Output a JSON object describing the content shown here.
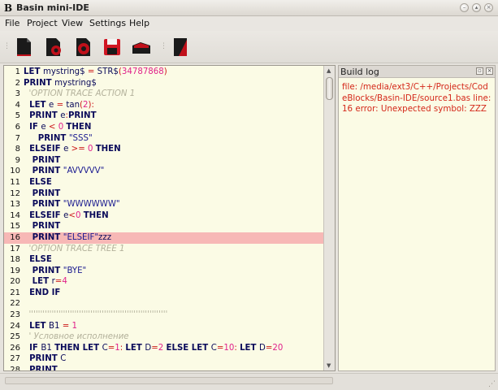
{
  "window": {
    "icon_letter": "B",
    "title": "Basin mini-IDE",
    "controls": [
      "minimize-icon",
      "maximize-icon",
      "close-icon"
    ]
  },
  "menu": [
    "File",
    "Project",
    "View",
    "Settings",
    "Help"
  ],
  "toolbar": {
    "buttons": [
      "new-file-icon",
      "open-gear-icon",
      "build-gear-icon",
      "save-icon",
      "run-icon",
      "notebook-icon"
    ]
  },
  "editor": {
    "highlight_line": 16,
    "lines": [
      {
        "n": "1",
        "t": [
          [
            "kw",
            "LET "
          ],
          [
            "id",
            "mystring$ "
          ],
          [
            "op",
            "= "
          ],
          [
            "id",
            "STR$"
          ],
          [
            "op",
            "("
          ],
          [
            "num",
            "34787868"
          ],
          [
            "op",
            ")"
          ]
        ]
      },
      {
        "n": "2",
        "t": [
          [
            "kw",
            "PRINT "
          ],
          [
            "id",
            "mystring$"
          ]
        ]
      },
      {
        "n": "3",
        "t": [
          [
            "cm",
            "  'OPTION TRACE ACTION 1"
          ]
        ]
      },
      {
        "n": "4",
        "t": [
          [
            "kw",
            "  LET "
          ],
          [
            "id",
            "e "
          ],
          [
            "op",
            "= "
          ],
          [
            "id",
            "tan"
          ],
          [
            "op",
            "("
          ],
          [
            "num",
            "2"
          ],
          [
            "op",
            "):"
          ]
        ]
      },
      {
        "n": "5",
        "t": [
          [
            "kw",
            "  PRINT "
          ],
          [
            "id",
            "e"
          ],
          [
            "op",
            ":"
          ],
          [
            "kw",
            "PRINT"
          ]
        ]
      },
      {
        "n": "6",
        "t": [
          [
            "kw",
            "  IF "
          ],
          [
            "id",
            "e "
          ],
          [
            "op",
            "< "
          ],
          [
            "num",
            "0 "
          ],
          [
            "kw",
            "THEN"
          ]
        ]
      },
      {
        "n": "7",
        "t": [
          [
            "kw",
            "     PRINT "
          ],
          [
            "str",
            "\"SSS\""
          ]
        ]
      },
      {
        "n": "8",
        "t": [
          [
            "kw",
            "  ELSEIF "
          ],
          [
            "id",
            "e "
          ],
          [
            "op",
            ">= "
          ],
          [
            "num",
            "0 "
          ],
          [
            "kw",
            "THEN"
          ]
        ]
      },
      {
        "n": "9",
        "t": [
          [
            "kw",
            "   PRINT"
          ]
        ]
      },
      {
        "n": "10",
        "t": [
          [
            "kw",
            "   PRINT "
          ],
          [
            "str",
            "\"AVVVVV\""
          ]
        ]
      },
      {
        "n": "11",
        "t": [
          [
            "kw",
            "  ELSE"
          ]
        ]
      },
      {
        "n": "12",
        "t": [
          [
            "kw",
            "   PRINT"
          ]
        ]
      },
      {
        "n": "13",
        "t": [
          [
            "kw",
            "   PRINT "
          ],
          [
            "str",
            "\"WWWWWW\""
          ]
        ]
      },
      {
        "n": "14",
        "t": [
          [
            "kw",
            "  ELSEIF "
          ],
          [
            "id",
            "e"
          ],
          [
            "op",
            "<"
          ],
          [
            "num",
            "0 "
          ],
          [
            "kw",
            "THEN"
          ]
        ]
      },
      {
        "n": "15",
        "t": [
          [
            "kw",
            "   PRINT"
          ]
        ]
      },
      {
        "n": "16",
        "t": [
          [
            "kw",
            "   PRINT "
          ],
          [
            "str",
            "\"ELSEIF\""
          ],
          [
            "id",
            "zzz"
          ]
        ]
      },
      {
        "n": "17",
        "t": [
          [
            "cm",
            "  'OPTION TRACE TREE 1"
          ]
        ]
      },
      {
        "n": "18",
        "t": [
          [
            "kw",
            "  ELSE"
          ]
        ]
      },
      {
        "n": "19",
        "t": [
          [
            "kw",
            "   PRINT "
          ],
          [
            "str",
            "\"BYE\""
          ]
        ]
      },
      {
        "n": "20",
        "t": [
          [
            "kw",
            "   LET "
          ],
          [
            "id",
            "r"
          ],
          [
            "op",
            "="
          ],
          [
            "num",
            "4"
          ]
        ]
      },
      {
        "n": "21",
        "t": [
          [
            "kw",
            "  END IF"
          ]
        ]
      },
      {
        "n": "22",
        "t": []
      },
      {
        "n": "23",
        "t": [
          [
            "cm",
            "  '''''''''''''''''''''''''''''''''''''''''''''''''''''''''''''"
          ]
        ]
      },
      {
        "n": "24",
        "t": [
          [
            "kw",
            "  LET "
          ],
          [
            "id",
            "B1 "
          ],
          [
            "op",
            "= "
          ],
          [
            "num",
            "1"
          ]
        ]
      },
      {
        "n": "25",
        "t": [
          [
            "cm",
            "  ' Условное исполнение"
          ]
        ]
      },
      {
        "n": "26",
        "t": [
          [
            "kw",
            "  IF "
          ],
          [
            "id",
            "B1 "
          ],
          [
            "kw",
            "THEN LET "
          ],
          [
            "id",
            "C"
          ],
          [
            "op",
            "="
          ],
          [
            "num",
            "1"
          ],
          [
            "op",
            ": "
          ],
          [
            "kw",
            "LET "
          ],
          [
            "id",
            "D"
          ],
          [
            "op",
            "="
          ],
          [
            "num",
            "2 "
          ],
          [
            "kw",
            "ELSE LET "
          ],
          [
            "id",
            "C"
          ],
          [
            "op",
            "="
          ],
          [
            "num",
            "10"
          ],
          [
            "op",
            ": "
          ],
          [
            "kw",
            "LET "
          ],
          [
            "id",
            "D"
          ],
          [
            "op",
            "="
          ],
          [
            "num",
            "20"
          ]
        ]
      },
      {
        "n": "27",
        "t": [
          [
            "kw",
            "  PRINT "
          ],
          [
            "id",
            "C"
          ]
        ]
      },
      {
        "n": "28",
        "t": [
          [
            "kw",
            "  PRINT"
          ]
        ]
      }
    ]
  },
  "build_log": {
    "title": "Build log",
    "message": "file: /media/ext3/C++/Projects/CodeBlocks/Basin-IDE/source1.bas line: 16 error: Unexpected symbol: ZZZ"
  }
}
